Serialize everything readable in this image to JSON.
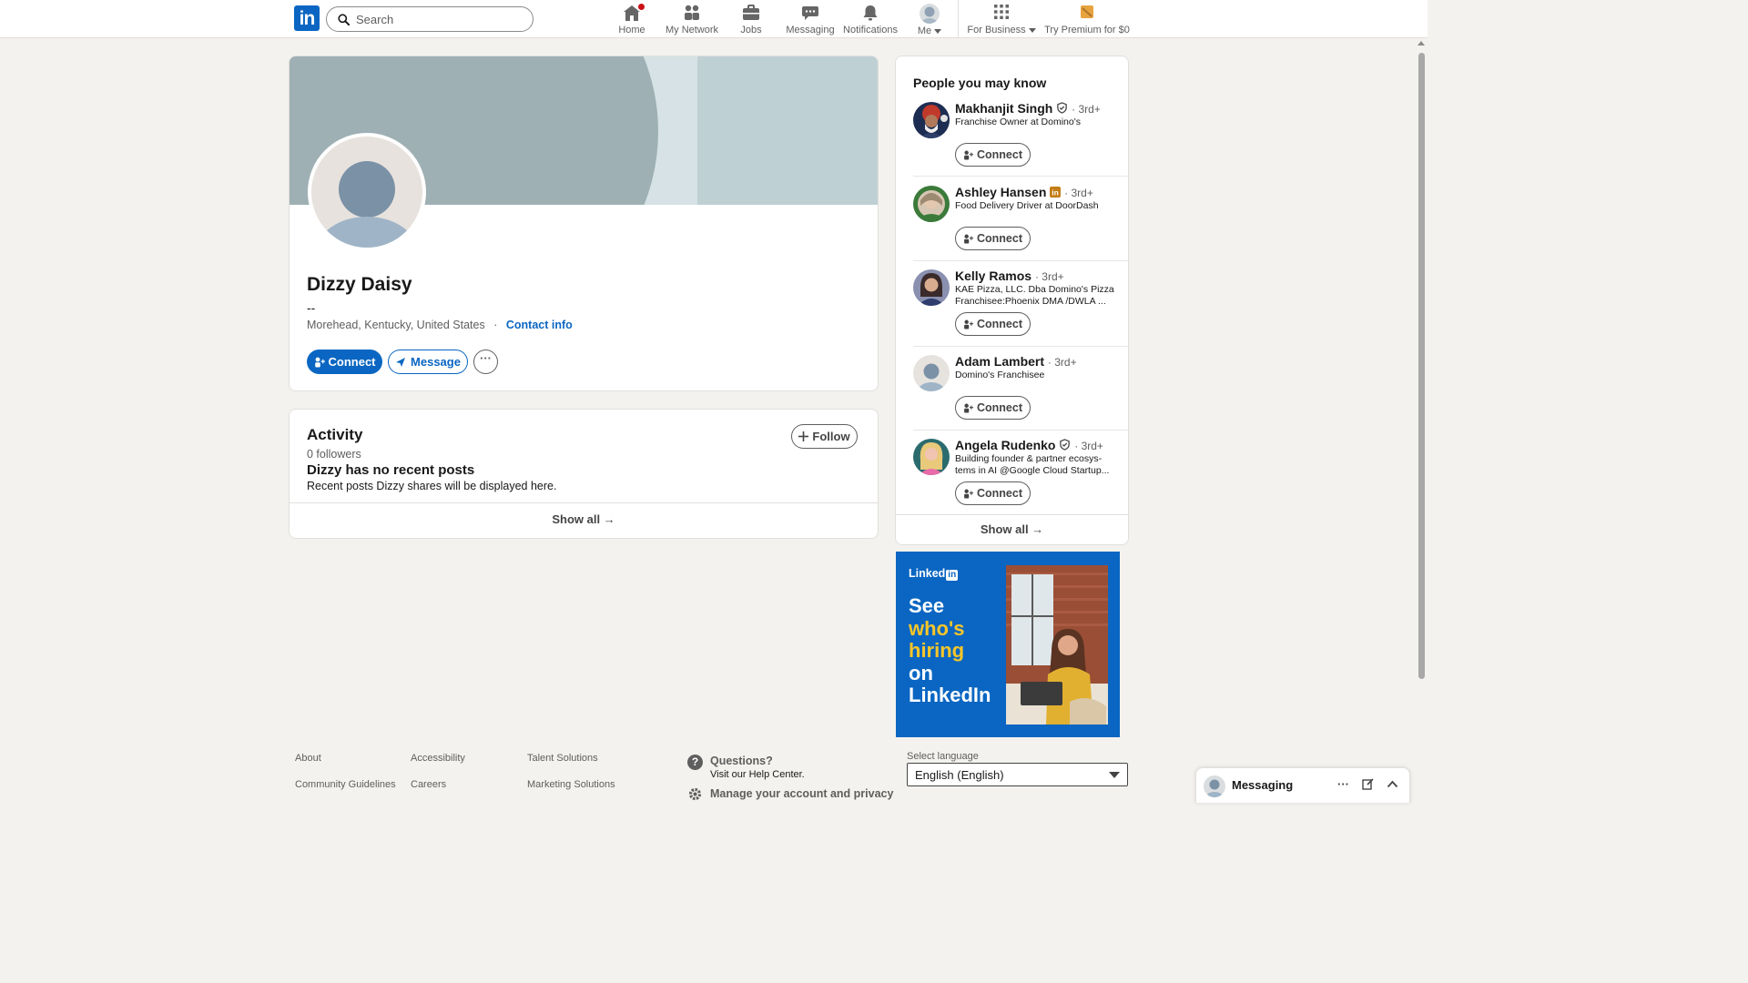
{
  "nav": {
    "logo": "in",
    "search_placeholder": "Search",
    "items": [
      {
        "label": "Home"
      },
      {
        "label": "My Network"
      },
      {
        "label": "Jobs"
      },
      {
        "label": "Messaging"
      },
      {
        "label": "Notifications"
      },
      {
        "label": "Me"
      },
      {
        "label": "For Business"
      },
      {
        "label": "Try Premium for $0"
      }
    ],
    "colors": {
      "brand": "#0a66c2",
      "badge": "#cc1016",
      "premium": "#e7a33e"
    }
  },
  "profile": {
    "name": "Dizzy Daisy",
    "headline": "--",
    "location": "Morehead, Kentucky, United States",
    "separator": "·",
    "contact_info": "Contact info",
    "connect_label": "Connect",
    "message_label": "Message",
    "more_label": "···"
  },
  "activity": {
    "title": "Activity",
    "followers": "0 followers",
    "follow_label": "Follow",
    "no_posts": "Dizzy has no recent posts",
    "no_posts_sub": "Recent posts Dizzy shares will be displayed here.",
    "show_all": "Show all →"
  },
  "people": {
    "title": "People you may know",
    "show_all": "Show all →",
    "connect_label": "Connect",
    "list": [
      {
        "name": "Makhanjit Singh",
        "badge": "verified-icon",
        "degree": "· 3rd+",
        "title": "Franchise Owner at Domino's"
      },
      {
        "name": "Ashley Hansen",
        "badge": "linkedin-premium-icon",
        "degree": "· 3rd+",
        "title": "Food Delivery Driver at DoorDash"
      },
      {
        "name": "Kelly Ramos",
        "badge": "",
        "degree": "· 3rd+",
        "title": "KAE Pizza, LLC. Dba Domino's Pizza Franchisee:Phoenix DMA /DWLA ..."
      },
      {
        "name": "Adam Lambert",
        "badge": "",
        "degree": "· 3rd+",
        "title": "Domino's Franchisee"
      },
      {
        "name": "Angela Rudenko",
        "badge": "verified-icon",
        "degree": "· 3rd+",
        "title": "Building founder & partner ecosys-tems in AI @Google Cloud Startup..."
      }
    ]
  },
  "ad": {
    "brand": "Linked",
    "brand_in": "in",
    "line1": "See",
    "line2": "who's",
    "line3": "hiring",
    "line4": "on",
    "line5": "LinkedIn"
  },
  "footer": {
    "links": [
      "About",
      "Accessibility",
      "Talent Solutions",
      "Community Guidelines",
      "Careers",
      "Marketing Solutions"
    ],
    "questions_title": "Questions?",
    "questions_sub": "Visit our Help Center.",
    "manage": "Manage your account and privacy",
    "language_label": "Select language",
    "language_value": "English (English)"
  },
  "messaging": {
    "label": "Messaging",
    "more": "···"
  }
}
